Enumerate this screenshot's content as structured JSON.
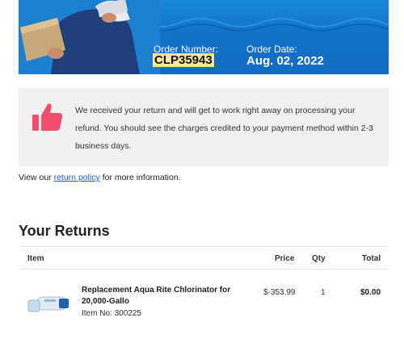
{
  "order": {
    "number_label": "Order Number:",
    "number": "CLP35943",
    "date_label": "Order Date:",
    "date": "Aug. 02, 2022"
  },
  "message": {
    "text": "We received your return and will get to work right away on processing your refund. You should see the charges credited to your payment method within 2-3 business days.",
    "icon": "thumbs-up-icon"
  },
  "policy": {
    "prefix": "View our ",
    "link": "return policy",
    "suffix": " for more information."
  },
  "returns": {
    "title": "Your Returns",
    "columns": [
      "Item",
      "Price",
      "Qty",
      "Total"
    ],
    "items": [
      {
        "name": "Replacement Aqua Rite Chlorinator for 20,000-Gallo",
        "item_no": "Item No: 300225",
        "price": "$-353.99",
        "qty": "1",
        "total": "$0.00"
      }
    ]
  },
  "colors": {
    "banner": "#0f6cc4",
    "highlight": "#ffe79a",
    "thumb": "#f0506e",
    "link": "#1a5fc8",
    "message_bg": "#f1f1f1"
  }
}
